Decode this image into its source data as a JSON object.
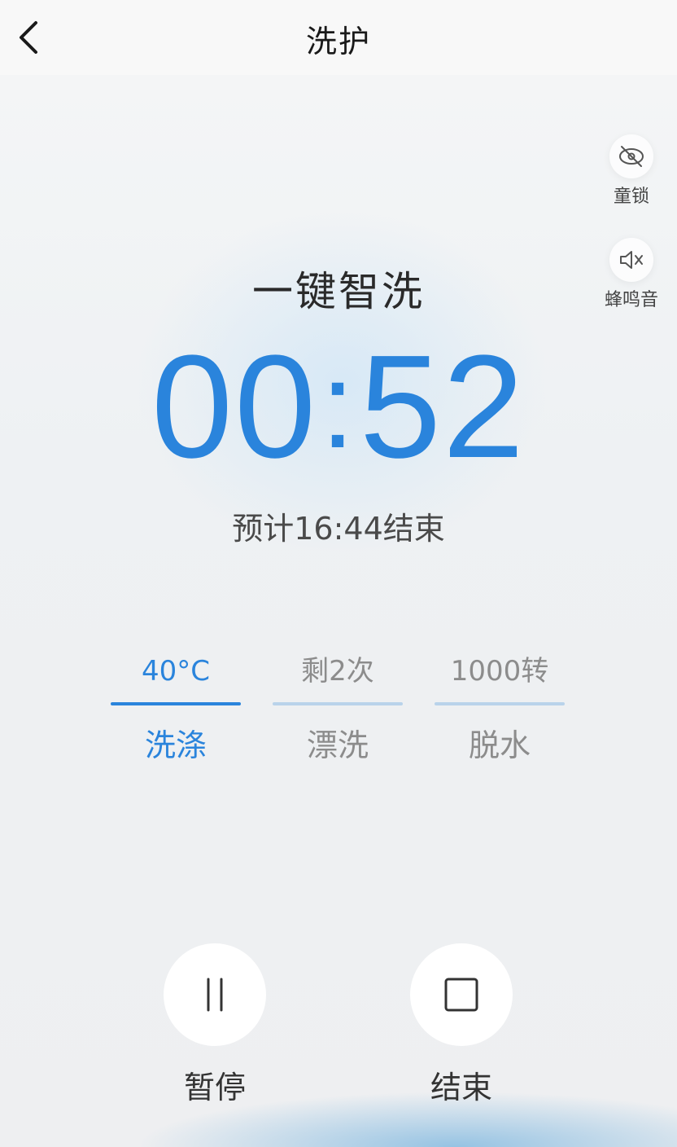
{
  "header": {
    "title": "洗护"
  },
  "side_controls": {
    "child_lock": {
      "label": "童锁",
      "icon": "child-lock-icon"
    },
    "buzzer": {
      "label": "蜂鸣音",
      "icon": "mute-speaker-icon"
    }
  },
  "program": {
    "name": "一键智洗",
    "timer_minutes": "00",
    "timer_seconds": "52",
    "eta": "预计16:44结束"
  },
  "phases": [
    {
      "value": "40°C",
      "label": "洗涤",
      "active": true
    },
    {
      "value": "剩2次",
      "label": "漂洗",
      "active": false
    },
    {
      "value": "1000转",
      "label": "脱水",
      "active": false
    }
  ],
  "actions": {
    "pause": {
      "label": "暂停",
      "icon": "pause-icon"
    },
    "stop": {
      "label": "结束",
      "icon": "stop-icon"
    }
  },
  "colors": {
    "accent": "#2a84dc",
    "inactive_text": "#8c8c8c",
    "inactive_bar": "#b9d3ea"
  }
}
